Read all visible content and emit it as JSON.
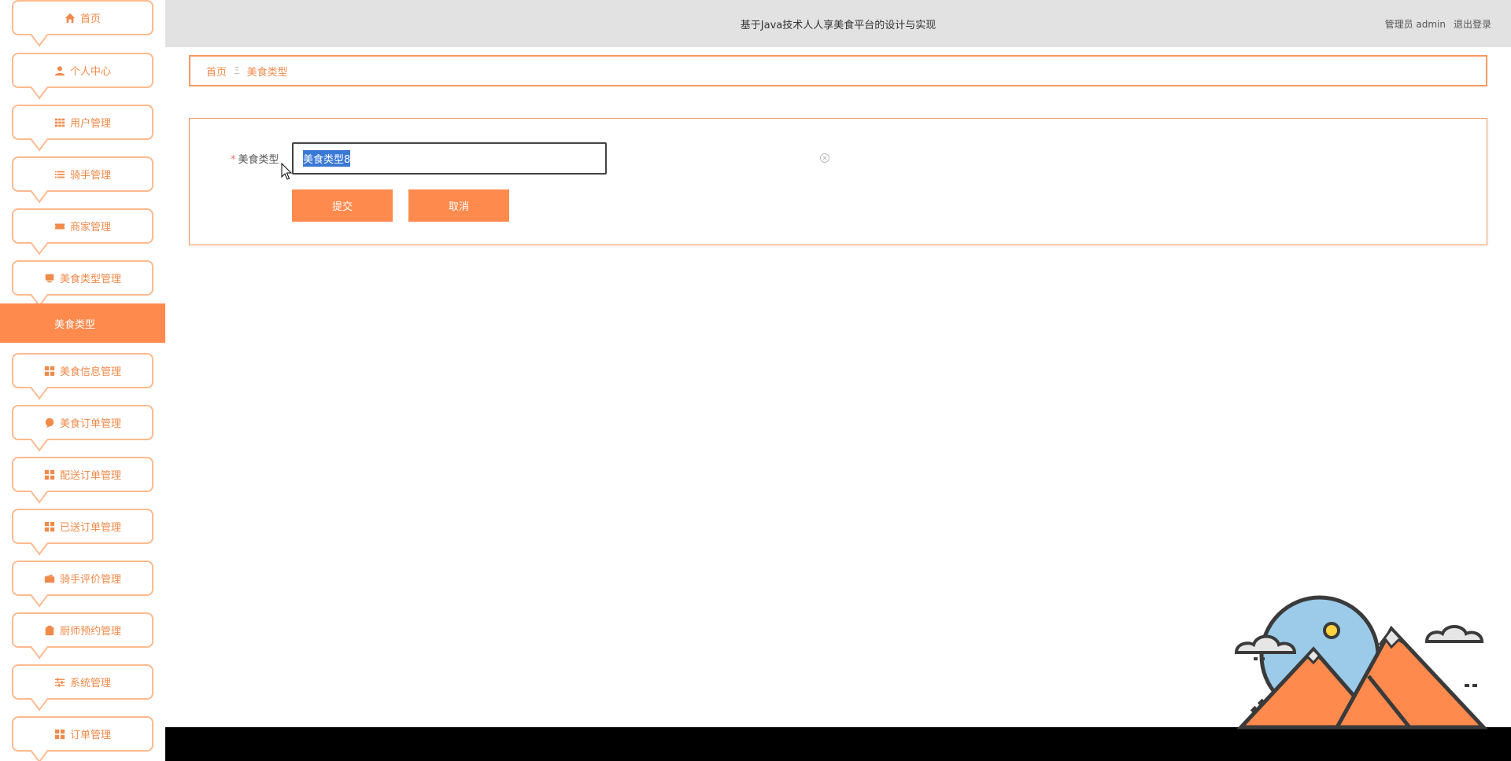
{
  "app": {
    "title": "基于Java技术人人享美食平台的设计与实现"
  },
  "header": {
    "user_label": "管理员 admin",
    "logout_label": "退出登录"
  },
  "sidebar": {
    "items": [
      {
        "label": "首页",
        "icon": "home-icon"
      },
      {
        "label": "个人中心",
        "icon": "user-icon"
      },
      {
        "label": "用户管理",
        "icon": "grid-icon"
      },
      {
        "label": "骑手管理",
        "icon": "list-icon"
      },
      {
        "label": "商家管理",
        "icon": "ticket-icon"
      },
      {
        "label": "美食类型管理",
        "icon": "monitor-icon"
      },
      {
        "label": "美食信息管理",
        "icon": "apps-icon"
      },
      {
        "label": "美食订单管理",
        "icon": "balloon-icon"
      },
      {
        "label": "配送订单管理",
        "icon": "apps-icon"
      },
      {
        "label": "已送订单管理",
        "icon": "apps-icon"
      },
      {
        "label": "骑手评价管理",
        "icon": "wallet-icon"
      },
      {
        "label": "厨师预约管理",
        "icon": "clipboard-icon"
      },
      {
        "label": "系统管理",
        "icon": "sliders-icon"
      },
      {
        "label": "订单管理",
        "icon": "apps-icon"
      }
    ],
    "active_sub": "美食类型"
  },
  "breadcrumb": {
    "home": "首页",
    "separator": "Ξ",
    "current": "美食类型"
  },
  "form": {
    "field_label": "美食类型",
    "required_mark": "*",
    "field_value": "美食类型8",
    "submit_label": "提交",
    "cancel_label": "取消"
  },
  "colors": {
    "accent": "#ff8a4d",
    "border": "#f79a62",
    "header_bg": "#e2e2e2",
    "selection": "#3a78d6"
  }
}
